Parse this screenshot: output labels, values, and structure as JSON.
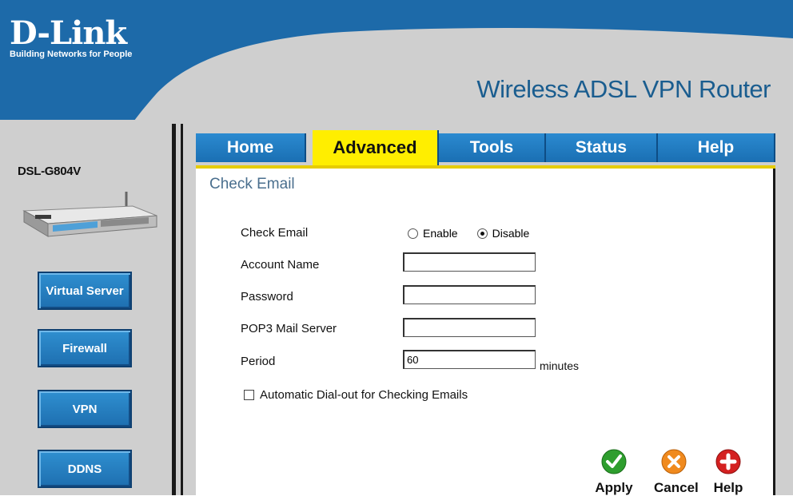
{
  "header": {
    "brand": "D-Link",
    "tagline": "Building Networks for People",
    "product": "Wireless ADSL VPN Router"
  },
  "sidebar": {
    "model": "DSL-G804V",
    "items": [
      {
        "label": "Virtual Server"
      },
      {
        "label": "Firewall"
      },
      {
        "label": "VPN"
      },
      {
        "label": "DDNS"
      }
    ]
  },
  "tabs": [
    {
      "label": "Home",
      "active": false
    },
    {
      "label": "Advanced",
      "active": true
    },
    {
      "label": "Tools",
      "active": false
    },
    {
      "label": "Status",
      "active": false
    },
    {
      "label": "Help",
      "active": false
    }
  ],
  "form": {
    "title": "Check Email",
    "check_email_label": "Check Email",
    "enable_label": "Enable",
    "disable_label": "Disable",
    "selected": "Disable",
    "account_label": "Account Name",
    "account_value": "",
    "password_label": "Password",
    "password_value": "",
    "pop3_label": "POP3 Mail Server",
    "pop3_value": "",
    "period_label": "Period",
    "period_value": "60",
    "period_unit": "minutes",
    "autodial_label": "Automatic Dial-out for Checking Emails",
    "autodial_checked": false
  },
  "actions": {
    "apply": "Apply",
    "cancel": "Cancel",
    "help": "Help"
  },
  "colors": {
    "header_blue": "#1e6aa8",
    "active_tab": "#ffee00",
    "apply_green": "#2e9e2e",
    "cancel_orange": "#f08a1e",
    "help_red": "#d42020"
  }
}
